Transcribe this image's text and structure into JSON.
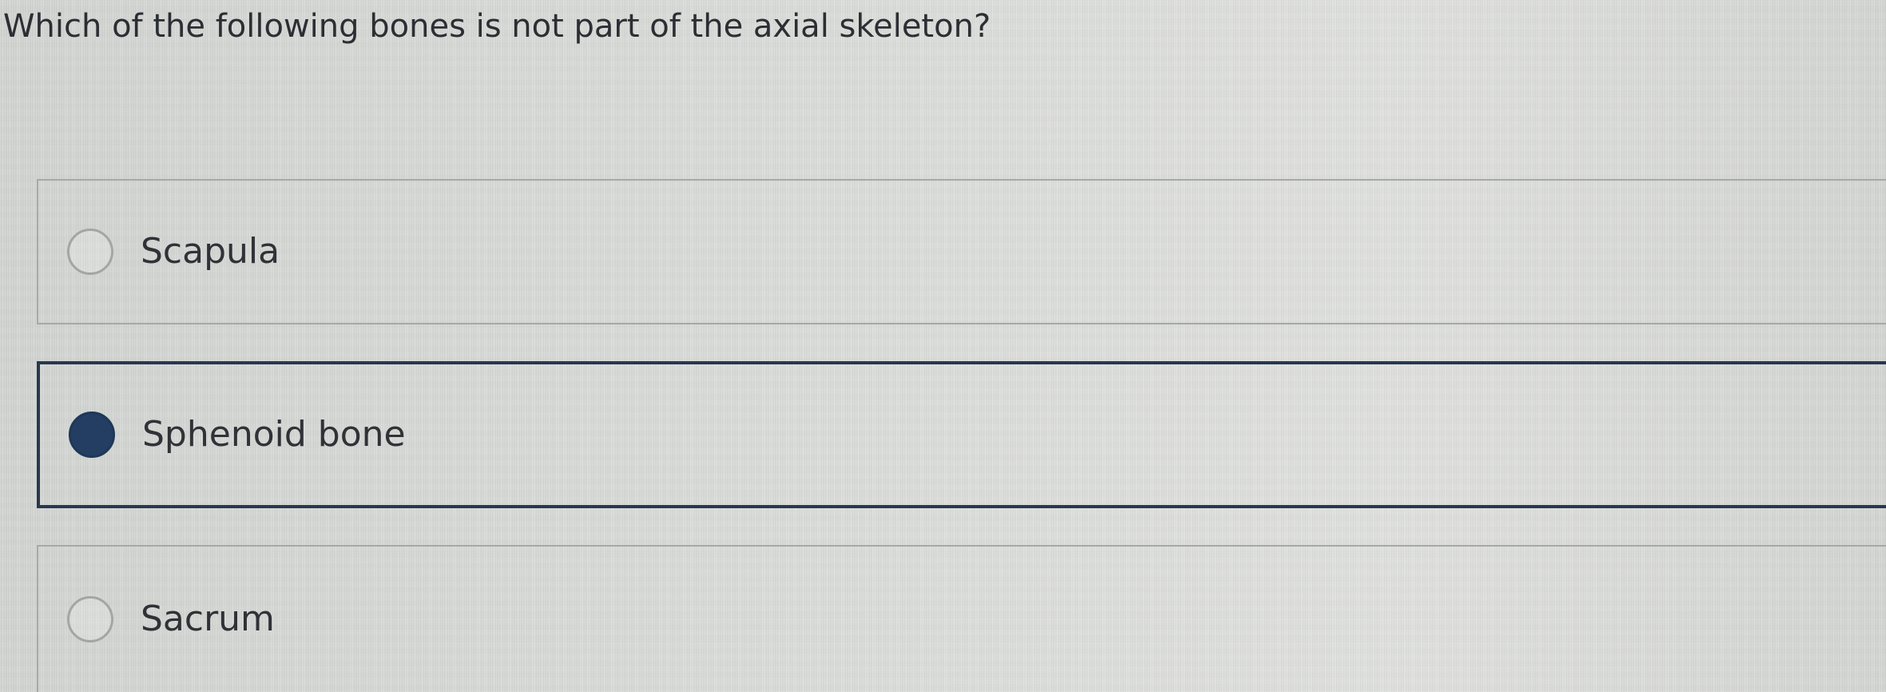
{
  "question": {
    "text": "Which of the following bones is not part of the axial skeleton?"
  },
  "options": [
    {
      "label": "Scapula",
      "selected": false
    },
    {
      "label": "Sphenoid bone",
      "selected": true
    },
    {
      "label": "Sacrum",
      "selected": false
    }
  ],
  "colors": {
    "selected_accent": "#243e63",
    "option_border": "#a6a9a6",
    "text": "#2b2e33"
  }
}
